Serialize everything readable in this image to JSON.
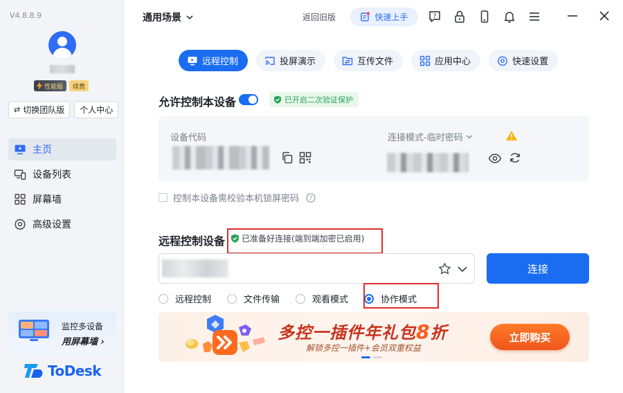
{
  "sidebar": {
    "version": "V4.8.8.9",
    "badge_performance": "性能版",
    "badge_renew": "续费",
    "switch_team": "切换团队版",
    "personal_center": "个人中心",
    "nav": [
      {
        "label": "主页",
        "icon": "monitor-icon",
        "active": true
      },
      {
        "label": "设备列表",
        "icon": "devices-icon",
        "active": false
      },
      {
        "label": "屏幕墙",
        "icon": "grid-icon",
        "active": false
      },
      {
        "label": "高级设置",
        "icon": "gear-icon",
        "active": false
      }
    ],
    "promo_line1": "监控多设备",
    "promo_line2": "用屏幕墙",
    "promo_arrow": "›",
    "logo_text": "ToDesk"
  },
  "topbar": {
    "scene": "通用场景",
    "back_old": "返回旧版",
    "quick_start": "快速上手"
  },
  "tabs": [
    {
      "label": "远程控制",
      "active": true
    },
    {
      "label": "投屏演示",
      "active": false
    },
    {
      "label": "互传文件",
      "active": false
    },
    {
      "label": "应用中心",
      "active": false
    },
    {
      "label": "快速设置",
      "active": false
    }
  ],
  "allow": {
    "title": "允许控制本设备",
    "enabled": true,
    "verify_badge": "已开启二次验证保护",
    "code_label": "设备代码",
    "mode_label": "连接模式-临时密码",
    "lock_check_label": "控制本设备需校验本机锁屏密码",
    "lock_check_checked": false
  },
  "remote": {
    "title": "远程控制设备",
    "status": "已准备好连接(端到端加密已启用)",
    "connect_label": "连接",
    "modes": [
      {
        "label": "远程控制",
        "checked": false
      },
      {
        "label": "文件传输",
        "checked": false
      },
      {
        "label": "观看模式",
        "checked": false
      },
      {
        "label": "协作模式",
        "checked": true
      }
    ]
  },
  "banner": {
    "title_pre": "多控一插件年礼包",
    "title_num": "8",
    "title_post": "折",
    "subtitle": "解锁多控一插件+会员双重权益",
    "buy_label": "立即购买"
  },
  "colors": {
    "accent": "#1a6df0",
    "sidebar_bg": "#f2f4f8",
    "highlight_red": "#e02b2b",
    "success_green": "#2aa45a"
  }
}
